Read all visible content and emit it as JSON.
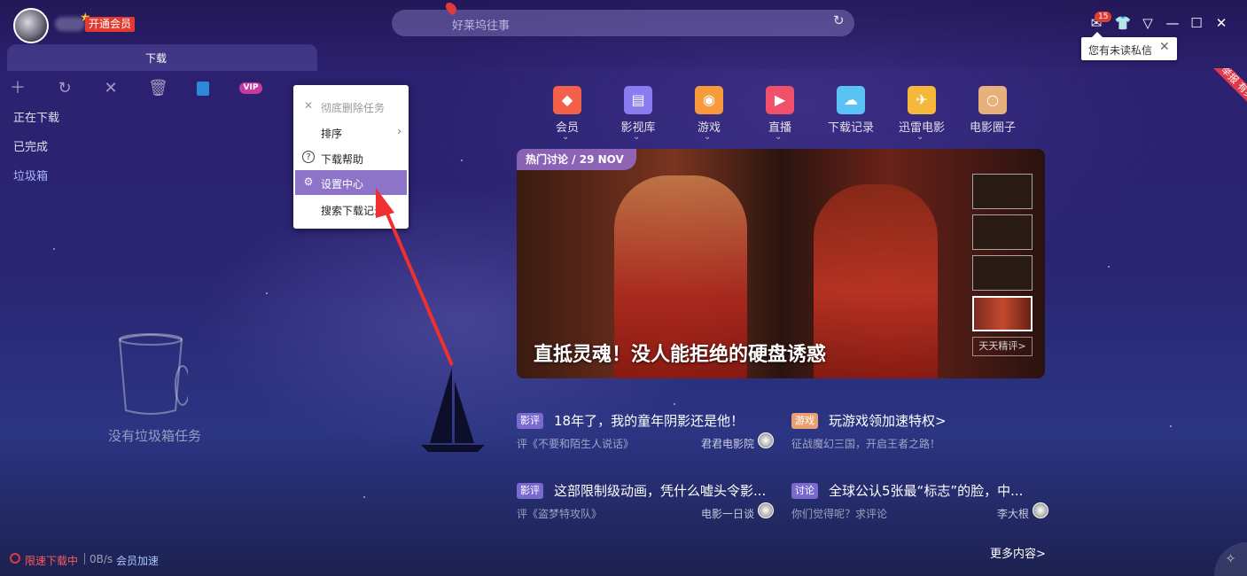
{
  "header": {
    "vip_label": "开通会员",
    "search_placeholder": "好莱坞往事",
    "message_count": "15",
    "tooltip_text": "您有未读私信",
    "icons": [
      "avatar",
      "crown-icon",
      "refresh-icon",
      "mail-icon",
      "skin-icon",
      "menu-icon",
      "minimize-icon",
      "maximize-icon",
      "close-icon"
    ]
  },
  "tab": {
    "label": "下载"
  },
  "sidebar": {
    "items": [
      {
        "label": "正在下载"
      },
      {
        "label": "已完成"
      },
      {
        "label": "垃圾箱"
      }
    ]
  },
  "toolbar": {
    "icons": [
      "plus-icon",
      "refresh-icon",
      "close-icon",
      "trash-icon",
      "phone-icon",
      "vip-icon"
    ],
    "vip_label": "VIP"
  },
  "context_menu": {
    "items": [
      {
        "label": "彻底删除任务",
        "icon": "close-icon",
        "disabled": true
      },
      {
        "label": "排序",
        "has_submenu": true
      },
      {
        "label": "下载帮助",
        "icon": "help-icon"
      },
      {
        "label": "设置中心",
        "icon": "gear-icon",
        "active": true
      },
      {
        "label": "搜索下载记录"
      }
    ]
  },
  "trash": {
    "empty_text": "没有垃圾箱任务"
  },
  "categories": [
    {
      "label": "会员",
      "color": "#f4614a",
      "icon": "diamond-icon",
      "chevron": true
    },
    {
      "label": "影视库",
      "color": "#8a7cf0",
      "icon": "film-icon",
      "chevron": true
    },
    {
      "label": "游戏",
      "color": "#f79a3b",
      "icon": "gamepad-icon",
      "chevron": true
    },
    {
      "label": "直播",
      "color": "#f0506a",
      "icon": "tv-icon",
      "chevron": true
    },
    {
      "label": "下载记录",
      "color": "#5bc2f5",
      "icon": "cloud-icon",
      "chevron": false
    },
    {
      "label": "迅雷电影",
      "color": "#f5b83a",
      "icon": "bird-icon",
      "chevron": true
    },
    {
      "label": "电影圈子",
      "color": "#e8b07a",
      "icon": "circle-icon",
      "chevron": false
    }
  ],
  "banner": {
    "tag": "热门讨论 / 29 NOV",
    "title": "直抵灵魂！没人能拒绝的硬盘诱惑",
    "more_label": "天天精评>"
  },
  "news": [
    {
      "tag": "影评",
      "tag_color": "#7a6ad0",
      "title": "18年了，我的童年阴影还是他！",
      "sub": "评《不要和陌生人说话》",
      "author": "君君电影院"
    },
    {
      "tag": "游戏",
      "tag_color": "#e8a070",
      "title": "玩游戏领加速特权>",
      "sub": "征战魔幻三国，开启王者之路！",
      "author": ""
    },
    {
      "tag": "影评",
      "tag_color": "#7a6ad0",
      "title": "这部限制级动画，凭什么嘘头令影...",
      "sub": "评《盗梦特攻队》",
      "author": "电影一日谈"
    },
    {
      "tag": "讨论",
      "tag_color": "#7a6ad0",
      "title": "全球公认5张最“标志”的脸，中...",
      "sub": "你们觉得呢？求评论",
      "author": "李大根"
    }
  ],
  "more_content": "更多内容>",
  "status": {
    "limit_text": "限速下载中",
    "speed": "0B/s",
    "boost": "会员加速"
  },
  "ribbon_text": "举报 有奖反馈"
}
